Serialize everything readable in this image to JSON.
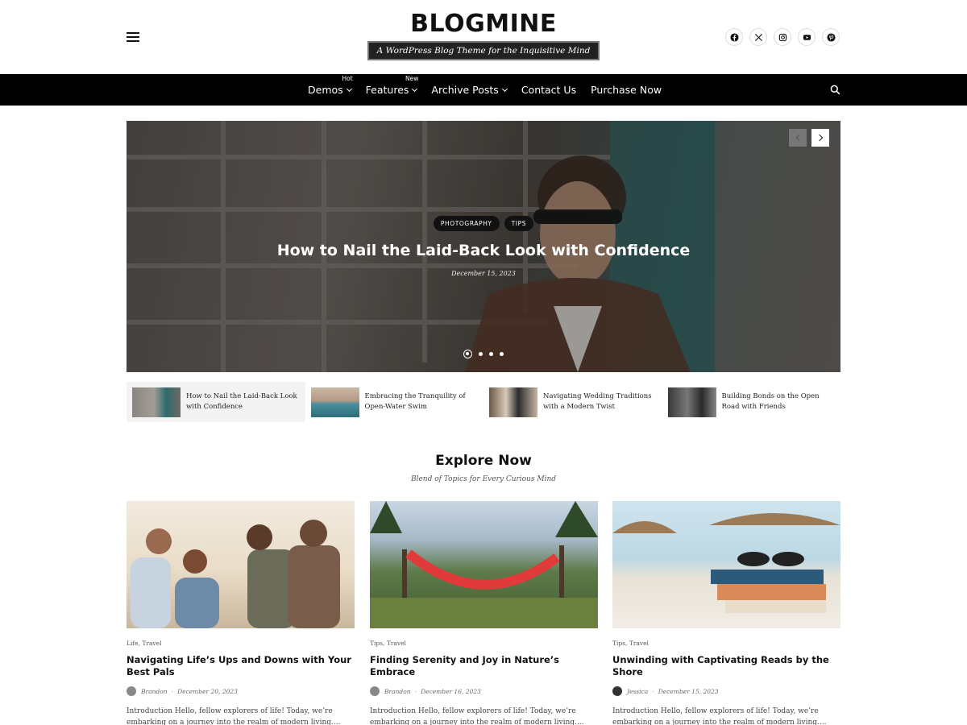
{
  "header": {
    "logo": "BLOGMINE",
    "tagline": "A WordPress Blog Theme for the Inquisitive Mind",
    "socials": [
      "facebook-icon",
      "x-icon",
      "instagram-icon",
      "youtube-icon",
      "pinterest-icon"
    ]
  },
  "nav": {
    "items": [
      {
        "label": "Demos",
        "badge": "Hot",
        "dropdown": true
      },
      {
        "label": "Features",
        "badge": "New",
        "dropdown": true
      },
      {
        "label": "Archive Posts",
        "badge": "",
        "dropdown": true
      },
      {
        "label": "Contact Us",
        "badge": "",
        "dropdown": false
      },
      {
        "label": "Purchase Now",
        "badge": "",
        "dropdown": false
      }
    ]
  },
  "hero": {
    "tags": [
      "PHOTOGRAPHY",
      "TIPS"
    ],
    "title": "How to Nail the Laid-Back Look with Confidence",
    "date": "December 15, 2023",
    "slide_count": 4,
    "active_slide": 1
  },
  "thumbs": [
    {
      "title": "How to Nail the Laid-Back Look with Confidence",
      "active": true
    },
    {
      "title": "Embracing the Tranquility of Open-Water Swim",
      "active": false
    },
    {
      "title": "Navigating Wedding Traditions with a Modern Twist",
      "active": false
    },
    {
      "title": "Building Bonds on the Open Road with Friends",
      "active": false
    }
  ],
  "explore": {
    "title": "Explore Now",
    "subtitle": "Blend of Topics for Every Curious Mind"
  },
  "cards": [
    {
      "cats": "Life, Travel",
      "title": "Navigating Life’s Ups and Downs with Your Best Pals",
      "author": "Brandon",
      "date": "December 20, 2023",
      "excerpt": "Introduction Hello, fellow explorers of life! Today, we’re embarking on a journey into the realm of modern living...."
    },
    {
      "cats": "Tips, Travel",
      "title": "Finding Serenity and Joy in Nature’s Embrace",
      "author": "Brandon",
      "date": "December 16, 2023",
      "excerpt": "Introduction Hello, fellow explorers of life! Today, we’re embarking on a journey into the realm of modern living...."
    },
    {
      "cats": "Tips, Travel",
      "title": "Unwinding with Captivating Reads by the Shore",
      "author": "Jessica",
      "date": "December 15, 2023",
      "excerpt": "Introduction Hello, fellow explorers of life! Today, we’re embarking on a journey into the realm of modern living...."
    }
  ],
  "colors": {
    "nav_bg": "#000000",
    "tag_bg": "#111111",
    "tagline_bg": "#222222"
  }
}
